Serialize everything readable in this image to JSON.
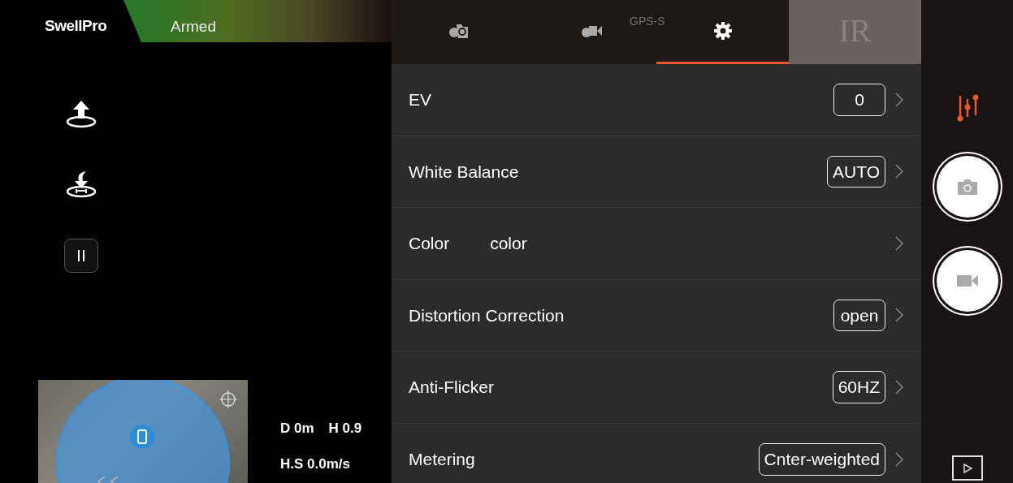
{
  "logo": {
    "text": "SwellPro"
  },
  "flight_status": {
    "label": "Armed"
  },
  "status_bar": {
    "gps": "GPS-S"
  },
  "tabs": [
    {
      "kind": "photo-settings",
      "selected": false
    },
    {
      "kind": "video-settings",
      "selected": false
    },
    {
      "kind": "general-settings",
      "selected": true
    },
    {
      "kind": "text",
      "label": "IR",
      "selected": false
    }
  ],
  "settings": [
    {
      "label": "EV",
      "kind": "boxed",
      "value": "0"
    },
    {
      "label": "White Balance",
      "kind": "boxed",
      "value": "AUTO"
    },
    {
      "label": "Color",
      "kind": "inline",
      "value": "color"
    },
    {
      "label": "Distortion Correction",
      "kind": "boxed",
      "value": "open"
    },
    {
      "label": "Anti-Flicker",
      "kind": "boxed",
      "value": "60HZ"
    },
    {
      "label": "Metering",
      "kind": "boxed",
      "value": "Cnter-weighted"
    }
  ],
  "telemetry": [
    [
      "D 0m",
      "H 0.9"
    ],
    [
      "H.S 0.0m/s"
    ]
  ]
}
